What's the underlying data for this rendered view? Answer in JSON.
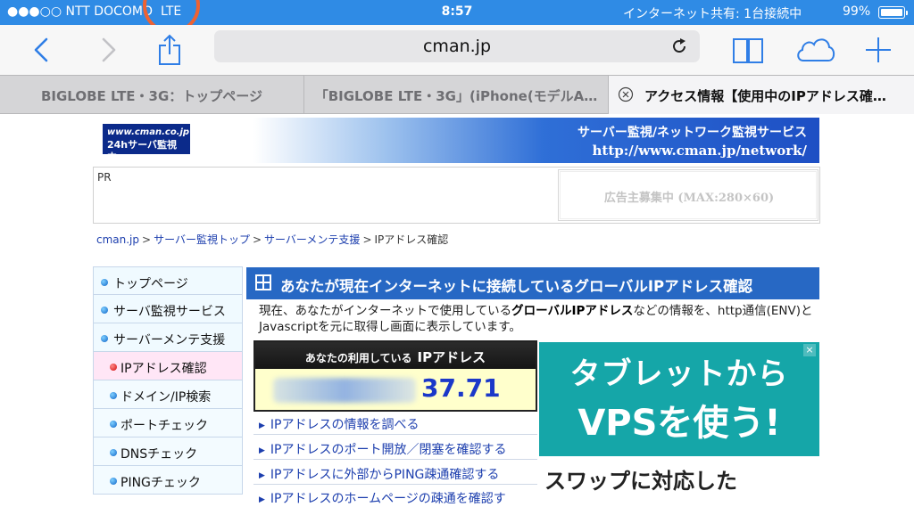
{
  "status_bar": {
    "carrier": "●●●○○ NTT DOCOMO",
    "network": "LTE",
    "time": "8:57",
    "hotspot": "インターネット共有: 1台接続中",
    "battery": "99%"
  },
  "toolbar": {
    "address": "cman.jp",
    "icons": [
      "back-icon",
      "forward-icon",
      "share-icon",
      "reload-icon",
      "bookmarks-icon",
      "icloud-tabs-icon",
      "new-tab-icon"
    ]
  },
  "tabs": [
    {
      "label": "BIGLOBE LTE・3G：トップページ"
    },
    {
      "label": "「BIGLOBE LTE・3G」(iPhone(モデルA…"
    },
    {
      "label": "アクセス情報【使用中のIPアドレス確…"
    }
  ],
  "banner": {
    "logo_line1": "www.cman.co.jp",
    "logo_line2": "24hサーバ監視中",
    "title": "サーバー監視/ネットワーク監視サービス",
    "url": "http://www.cman.jp/network/"
  },
  "pr": {
    "label": "PR",
    "ad_slot": "広告主募集中 (MAX:280×60)"
  },
  "breadcrumb": {
    "items": [
      "cman.jp",
      "サーバー監視トップ",
      "サーバーメンテ支援"
    ],
    "separator": ">",
    "current": "IPアドレス確認"
  },
  "sidenav": {
    "items": [
      {
        "label": "トップページ"
      },
      {
        "label": "サーバ監視サービス"
      },
      {
        "label": "サーバーメンテ支援"
      },
      {
        "label": "IPアドレス確認"
      },
      {
        "label": "ドメイン/IP検索"
      },
      {
        "label": "ポートチェック"
      },
      {
        "label": "DNSチェック"
      },
      {
        "label": "PINGチェック"
      }
    ]
  },
  "main": {
    "title": "あなたが現在インターネットに接続しているグローバルIPアドレス確認",
    "desc_1": "現在、あなたがインターネットで使用している",
    "desc_bold": "グローバルIPアドレス",
    "desc_2": "などの情報を、http通信(ENV)とJavascriptを元に取得し画面に表示しています。",
    "ip_panel_small": "あなたの利用している",
    "ip_panel_big": "IPアドレス",
    "ip_visible": "37.71",
    "links": [
      "IPアドレスの情報を調べる",
      "IPアドレスのポート開放／閉塞を確認する",
      "IPアドレスに外部からPING疎通確認する",
      "IPアドレスのホームページの疎通を確認す"
    ]
  },
  "ad": {
    "line1": "タブレットから",
    "line2": "VPSを使う!",
    "line3": "スワップに対応した",
    "close": "×",
    "bg_color": "#15a6a8"
  },
  "colors": {
    "status_bar": "#2f8be5",
    "accent": "#2f7ee6",
    "lte_circle": "#ee6233",
    "title_bar": "#2768c4"
  }
}
